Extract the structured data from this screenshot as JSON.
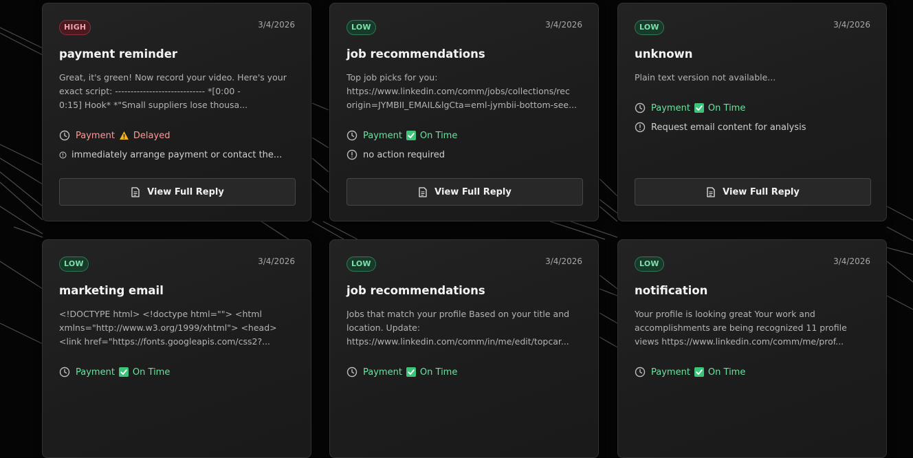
{
  "colors": {
    "background": "#050505",
    "card": "#1e1e1e",
    "low_badge": "#7de0aa",
    "high_badge": "#f0a0ac",
    "on_time": "#6fe0a0",
    "delayed": "#ff9a9a"
  },
  "cards": [
    {
      "priority": "HIGH",
      "date": "3/4/2026",
      "title": "payment reminder",
      "body": [
        "Great, it's green! Now record your video. Here's your",
        "exact script: ----------------------------- *[0:00 -",
        "0:15] Hook* *\"Small suppliers lose thousa..."
      ],
      "payment_label": "Payment",
      "payment_status_icon": "warning-icon",
      "payment_status": "Delayed",
      "action": "immediately arrange payment or contact the...",
      "button_label": "View Full Reply"
    },
    {
      "priority": "LOW",
      "date": "3/4/2026",
      "title": "job recommendations",
      "body": [
        "Top job picks for you:",
        "https://www.linkedin.com/comm/jobs/collections/rec",
        "origin=JYMBII_EMAIL&lgCta=eml-jymbii-bottom-see..."
      ],
      "payment_label": "Payment",
      "payment_status_icon": "check-icon",
      "payment_status": "On Time",
      "action": "no action required",
      "button_label": "View Full Reply"
    },
    {
      "priority": "LOW",
      "date": "3/4/2026",
      "title": "unknown",
      "body": [
        "Plain text version not available..."
      ],
      "payment_label": "Payment",
      "payment_status_icon": "check-icon",
      "payment_status": "On Time",
      "action": "Request email content for analysis",
      "button_label": "View Full Reply"
    },
    {
      "priority": "LOW",
      "date": "3/4/2026",
      "title": "marketing email",
      "body": [
        "<!DOCTYPE html> <!doctype html=\"\"> <html",
        "xmlns=\"http://www.w3.org/1999/xhtml\"> <head>",
        "<link href=\"https://fonts.googleapis.com/css2?..."
      ],
      "payment_label": "Payment",
      "payment_status_icon": "check-icon",
      "payment_status": "On Time",
      "action": "",
      "button_label": "View Full Reply"
    },
    {
      "priority": "LOW",
      "date": "3/4/2026",
      "title": "job recommendations",
      "body": [
        "Jobs that match your profile Based on your title and",
        "location. Update:",
        "https://www.linkedin.com/comm/in/me/edit/topcar..."
      ],
      "payment_label": "Payment",
      "payment_status_icon": "check-icon",
      "payment_status": "On Time",
      "action": "",
      "button_label": "View Full Reply"
    },
    {
      "priority": "LOW",
      "date": "3/4/2026",
      "title": "notification",
      "body": [
        "Your profile is looking great Your work and",
        "accomplishments are being recognized 11 profile",
        "views https://www.linkedin.com/comm/me/prof..."
      ],
      "payment_label": "Payment",
      "payment_status_icon": "check-icon",
      "payment_status": "On Time",
      "action": "",
      "button_label": "View Full Reply"
    }
  ]
}
